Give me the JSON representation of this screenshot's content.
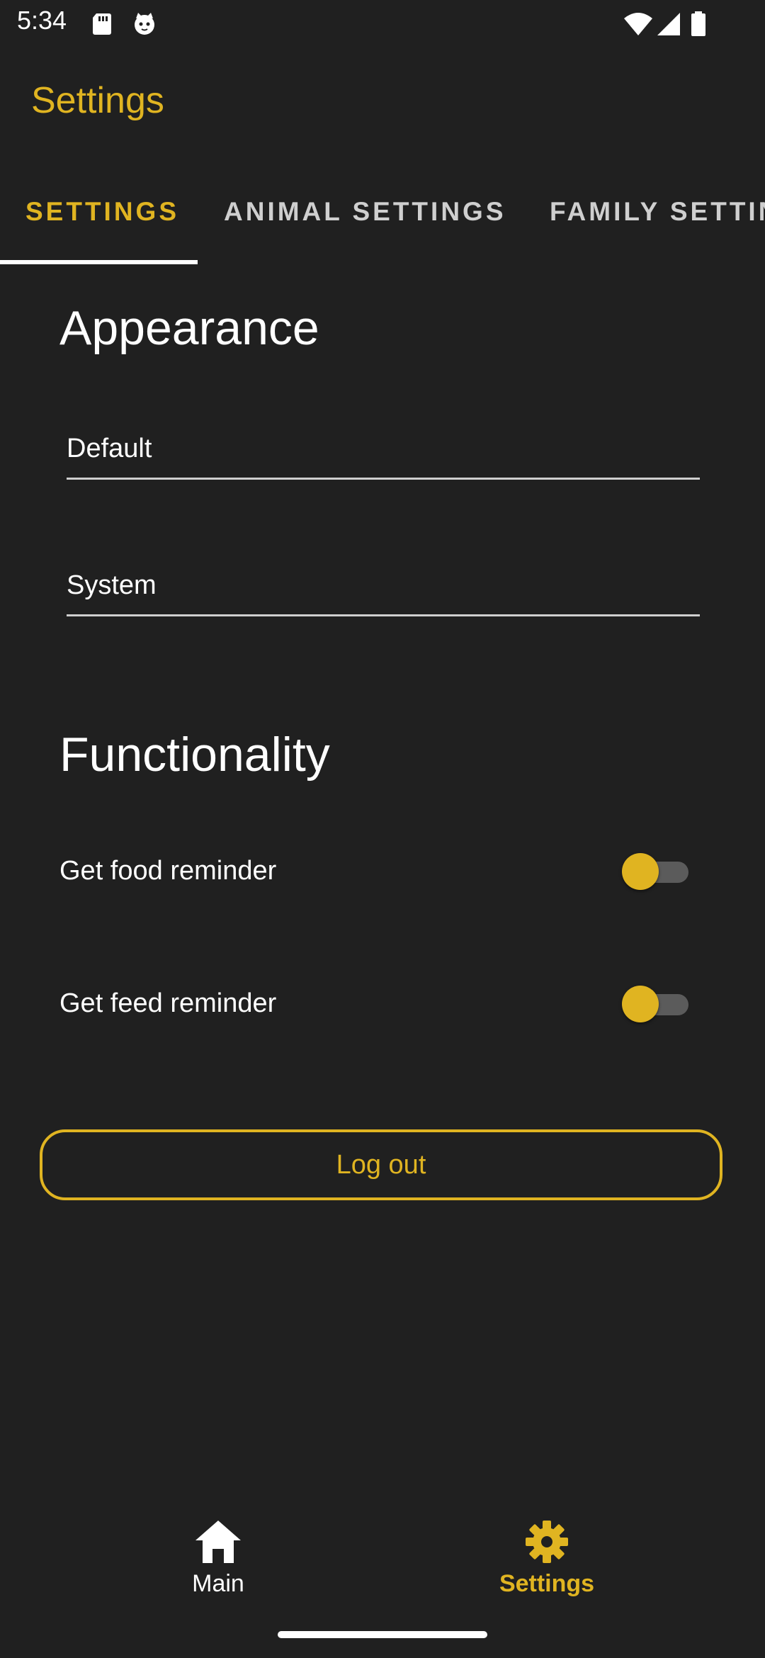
{
  "status_bar": {
    "time": "5:34",
    "icons": [
      "sd-card-icon",
      "cat-face-icon",
      "wifi-icon",
      "signal-icon",
      "battery-icon"
    ]
  },
  "app_bar": {
    "title": "Settings"
  },
  "tabs": [
    {
      "label": "SETTINGS",
      "active": true
    },
    {
      "label": "ANIMAL SETTINGS",
      "active": false
    },
    {
      "label": "FAMILY SETTIN",
      "active": false
    }
  ],
  "appearance": {
    "title": "Appearance",
    "fields": [
      {
        "value": "Default"
      },
      {
        "value": "System"
      }
    ]
  },
  "functionality": {
    "title": "Functionality",
    "toggles": [
      {
        "label": "Get food reminder",
        "checked": false
      },
      {
        "label": "Get feed reminder",
        "checked": false
      }
    ]
  },
  "logout": {
    "label": "Log out"
  },
  "bottom_nav": {
    "items": [
      {
        "label": "Main",
        "icon": "home-icon",
        "active": false
      },
      {
        "label": "Settings",
        "icon": "gear-icon",
        "active": true
      }
    ]
  },
  "colors": {
    "accent": "#e0b421",
    "background": "#202020",
    "text": "#ffffff"
  }
}
